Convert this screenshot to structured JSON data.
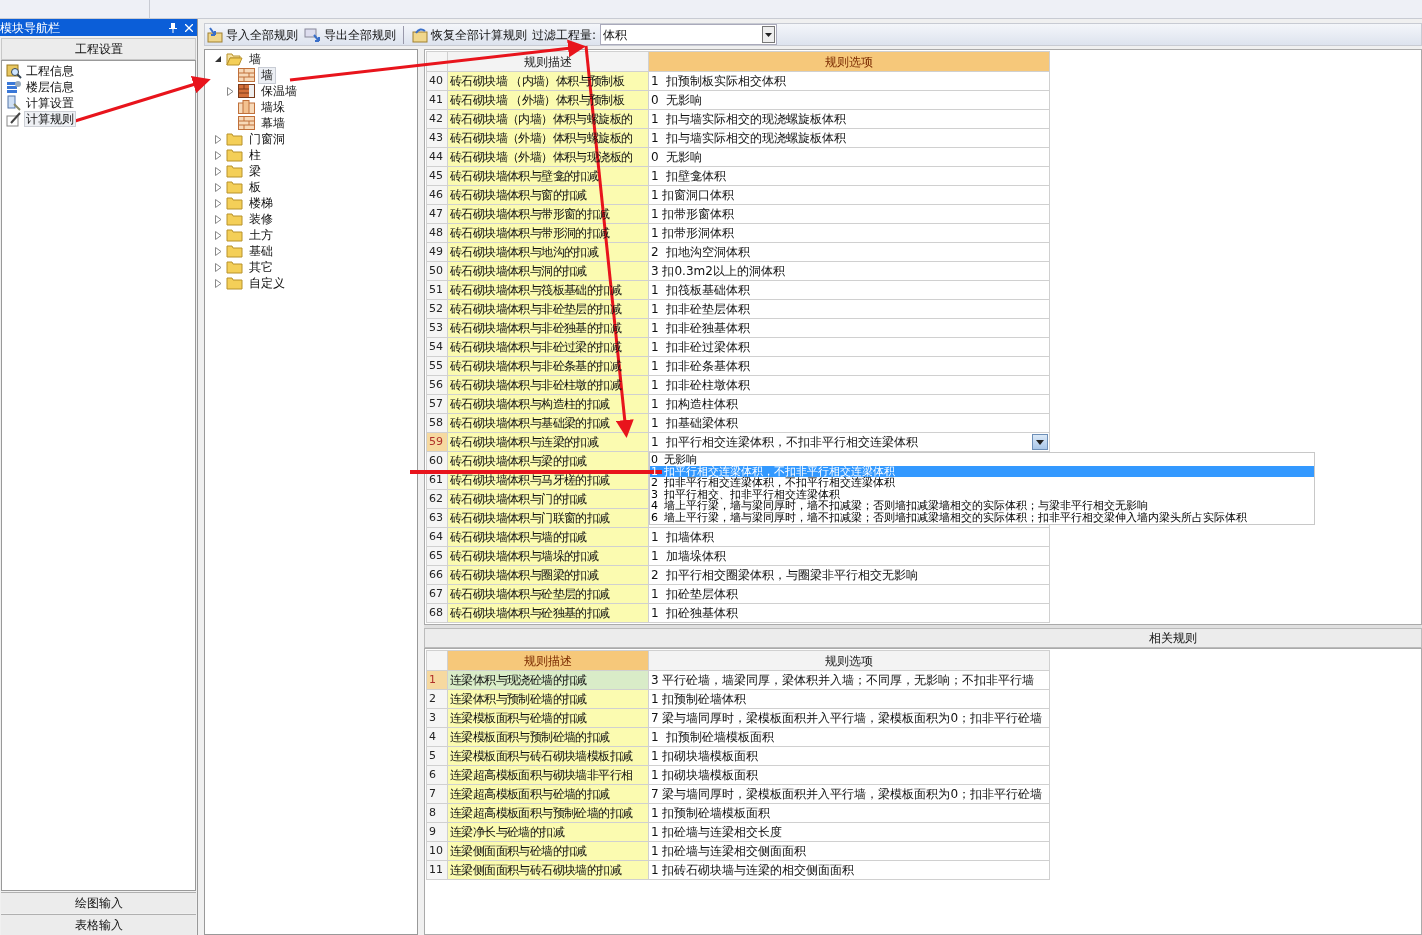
{
  "navigator": {
    "title": "模块导航栏",
    "section_button": "工程设置",
    "items": [
      {
        "label": "工程信息",
        "kind": "info",
        "selected": false
      },
      {
        "label": "楼层信息",
        "kind": "floors",
        "selected": false
      },
      {
        "label": "计算设置",
        "kind": "settings",
        "selected": false
      },
      {
        "label": "计算规则",
        "kind": "rules",
        "selected": true
      }
    ],
    "bottom_buttons": [
      "绘图输入",
      "表格输入"
    ]
  },
  "toolbar": {
    "buttons": [
      {
        "label": "导入全部规则",
        "kind": "import"
      },
      {
        "label": "导出全部规则",
        "kind": "export"
      },
      {
        "label": "恢复全部计算规则",
        "kind": "restore"
      }
    ],
    "filter_label": "过滤工程量:",
    "filter_value": "体积"
  },
  "tree": [
    {
      "label": "墙",
      "expanded": true,
      "selected": false,
      "children": [
        {
          "label": "墙",
          "kind": "wall",
          "selected": true,
          "has_children": false
        },
        {
          "label": "保温墙",
          "kind": "insulation",
          "selected": false,
          "has_children": true
        },
        {
          "label": "墙垛",
          "kind": "pier",
          "selected": false,
          "has_children": false
        },
        {
          "label": "幕墙",
          "kind": "wall",
          "selected": false,
          "has_children": false
        }
      ]
    },
    {
      "label": "门窗洞",
      "expanded": false,
      "selected": false
    },
    {
      "label": "柱",
      "expanded": false,
      "selected": false
    },
    {
      "label": "梁",
      "expanded": false,
      "selected": false
    },
    {
      "label": "板",
      "expanded": false,
      "selected": false
    },
    {
      "label": "楼梯",
      "expanded": false,
      "selected": false
    },
    {
      "label": "装修",
      "expanded": false,
      "selected": false
    },
    {
      "label": "土方",
      "expanded": false,
      "selected": false
    },
    {
      "label": "基础",
      "expanded": false,
      "selected": false
    },
    {
      "label": "其它",
      "expanded": false,
      "selected": false
    },
    {
      "label": "自定义",
      "expanded": false,
      "selected": false
    }
  ],
  "rules_table": {
    "columns": [
      {
        "label": "规则描述",
        "active": false
      },
      {
        "label": "规则选项",
        "active": true
      }
    ],
    "rows": [
      {
        "number": "40",
        "description": "砖石砌块墙 （内墙）体积与预制板",
        "option": "1  扣预制板实际相交体积",
        "selected": false
      },
      {
        "number": "41",
        "description": "砖石砌块墙 （外墙）体积与预制板",
        "option": "0  无影响",
        "selected": false
      },
      {
        "number": "42",
        "description": "砖石砌块墙（内墙）体积与螺旋板的",
        "option": "1  扣与墙实际相交的现浇螺旋板体积",
        "selected": false
      },
      {
        "number": "43",
        "description": "砖石砌块墙（外墙）体积与螺旋板的",
        "option": "1  扣与墙实际相交的现浇螺旋板体积",
        "selected": false
      },
      {
        "number": "44",
        "description": "砖石砌块墙（外墙）体积与现浇板的",
        "option": "0  无影响",
        "selected": false
      },
      {
        "number": "45",
        "description": "砖石砌块墙体积与壁龛的扣减",
        "option": "1  扣壁龛体积",
        "selected": false
      },
      {
        "number": "46",
        "description": "砖石砌块墙体积与窗的扣减",
        "option": "1 扣窗洞口体积",
        "selected": false
      },
      {
        "number": "47",
        "description": "砖石砌块墙体积与带形窗的扣减",
        "option": "1 扣带形窗体积",
        "selected": false
      },
      {
        "number": "48",
        "description": "砖石砌块墙体积与带形洞的扣减",
        "option": "1 扣带形洞体积",
        "selected": false
      },
      {
        "number": "49",
        "description": "砖石砌块墙体积与地沟的扣减",
        "option": "2  扣地沟空洞体积",
        "selected": false
      },
      {
        "number": "50",
        "description": "砖石砌块墙体积与洞的扣减",
        "option": "3 扣0.3m2以上的洞体积",
        "selected": false
      },
      {
        "number": "51",
        "description": "砖石砌块墙体积与筏板基础的扣减",
        "option": "1  扣筏板基础体积",
        "selected": false
      },
      {
        "number": "52",
        "description": "砖石砌块墙体积与非砼垫层的扣减",
        "option": "1  扣非砼垫层体积",
        "selected": false
      },
      {
        "number": "53",
        "description": "砖石砌块墙体积与非砼独基的扣减",
        "option": "1  扣非砼独基体积",
        "selected": false
      },
      {
        "number": "54",
        "description": "砖石砌块墙体积与非砼过梁的扣减",
        "option": "1  扣非砼过梁体积",
        "selected": false
      },
      {
        "number": "55",
        "description": "砖石砌块墙体积与非砼条基的扣减",
        "option": "1  扣非砼条基体积",
        "selected": false
      },
      {
        "number": "56",
        "description": "砖石砌块墙体积与非砼柱墩的扣减",
        "option": "1  扣非砼柱墩体积",
        "selected": false
      },
      {
        "number": "57",
        "description": "砖石砌块墙体积与构造柱的扣减",
        "option": "1  扣构造柱体积",
        "selected": false
      },
      {
        "number": "58",
        "description": "砖石砌块墙体积与基础梁的扣减",
        "option": "1  扣基础梁体积",
        "selected": false
      },
      {
        "number": "59",
        "description": "砖石砌块墙体积与连梁的扣减",
        "option": "1  扣平行相交连梁体积，不扣非平行相交连梁体积",
        "selected": true
      },
      {
        "number": "60",
        "description": "砖石砌块墙体积与梁的扣减",
        "selected": false
      },
      {
        "number": "61",
        "description": "砖石砌块墙体积与马牙槎的扣减",
        "selected": false
      },
      {
        "number": "62",
        "description": "砖石砌块墙体积与门的扣减",
        "selected": false
      },
      {
        "number": "63",
        "description": "砖石砌块墙体积与门联窗的扣减",
        "selected": false
      },
      {
        "number": "64",
        "description": "砖石砌块墙体积与墙的扣减",
        "option": "1  扣墙体积",
        "selected": false
      },
      {
        "number": "65",
        "description": "砖石砌块墙体积与墙垛的扣减",
        "option": "1  加墙垛体积",
        "selected": false
      },
      {
        "number": "66",
        "description": "砖石砌块墙体积与圈梁的扣减",
        "option": "2  扣平行相交圈梁体积，与圈梁非平行相交无影响",
        "selected": false
      },
      {
        "number": "67",
        "description": "砖石砌块墙体积与砼垫层的扣减",
        "option": "1  扣砼垫层体积",
        "selected": false
      },
      {
        "number": "68",
        "description": "砖石砌块墙体积与砼独基的扣减",
        "option": "1  扣砼独基体积",
        "selected": false
      }
    ],
    "dropdown": [
      {
        "code": "0",
        "text": "无影响",
        "selected": false
      },
      {
        "code": "1",
        "text": "扣平行相交连梁体积，不扣非平行相交连梁体积",
        "selected": true
      },
      {
        "code": "2",
        "text": "扣非平行相交连梁体积，不扣平行相交连梁体积",
        "selected": false
      },
      {
        "code": "3",
        "text": "扣平行相交、扣非平行相交连梁体积",
        "selected": false
      },
      {
        "code": "4",
        "text": "墙上平行梁，墙与梁同厚时，墙不扣减梁；否则墙扣减梁墙相交的实际体积；与梁非平行相交无影响",
        "selected": false
      },
      {
        "code": "6",
        "text": "墙上平行梁，墙与梁同厚时，墙不扣减梁；否则墙扣减梁墙相交的实际体积；扣非平行相交梁伸入墙内梁头所占实际体积",
        "selected": false
      }
    ]
  },
  "related_rules": {
    "title": "相关规则",
    "columns": [
      {
        "label": "规则描述",
        "active": true
      },
      {
        "label": "规则选项",
        "active": false
      }
    ],
    "rows": [
      {
        "number": "1",
        "description": "连梁体积与现浇砼墙的扣减",
        "option": "3 平行砼墙，墙梁同厚，梁体积并入墙；不同厚，无影响；不扣非平行墙",
        "selected": true
      },
      {
        "number": "2",
        "description": "连梁体积与预制砼墙的扣减",
        "option": "1 扣预制砼墙体积",
        "selected": false
      },
      {
        "number": "3",
        "description": "连梁模板面积与砼墙的扣减",
        "option": "7 梁与墙同厚时，梁模板面积并入平行墙，梁模板面积为0；扣非平行砼墙",
        "selected": false
      },
      {
        "number": "4",
        "description": "连梁模板面积与预制砼墙的扣减",
        "option": "1  扣预制砼墙模板面积",
        "selected": false
      },
      {
        "number": "5",
        "description": "连梁模板面积与砖石砌块墙模板扣减",
        "option": "1 扣砌块墙模板面积",
        "selected": false
      },
      {
        "number": "6",
        "description": "连梁超高模板面积与砌块墙非平行相",
        "option": "1 扣砌块墙模板面积",
        "selected": false
      },
      {
        "number": "7",
        "description": "连梁超高模板面积与砼墙的扣减",
        "option": "7 梁与墙同厚时，梁模板面积并入平行墙，梁模板面积为0；扣非平行砼墙",
        "selected": false
      },
      {
        "number": "8",
        "description": "连梁超高模板面积与预制砼墙的扣减",
        "option": "1 扣预制砼墙模板面积",
        "selected": false
      },
      {
        "number": "9",
        "description": "连梁净长与砼墙的扣减",
        "option": "1 扣砼墙与连梁相交长度",
        "selected": false
      },
      {
        "number": "10",
        "description": "连梁侧面面积与砼墙的扣减",
        "option": "1 扣砼墙与连梁相交侧面面积",
        "selected": false
      },
      {
        "number": "11",
        "description": "连梁侧面面积与砖石砌块墙的扣减",
        "option": "1 扣砖石砌块墙与连梁的相交侧面面积",
        "selected": false
      }
    ]
  }
}
